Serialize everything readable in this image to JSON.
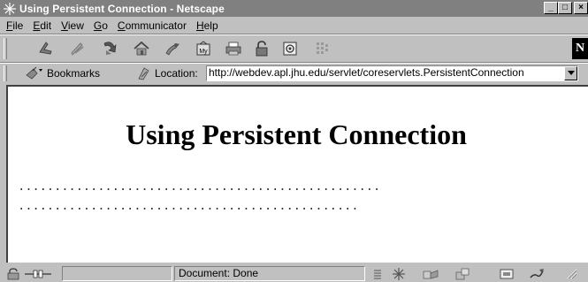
{
  "window": {
    "title": "Using Persistent Connection - Netscape",
    "buttons": {
      "minimize": "_",
      "maximize": "□",
      "close": "×"
    }
  },
  "menubar": {
    "items": [
      {
        "accel": "F",
        "rest": "ile"
      },
      {
        "accel": "E",
        "rest": "dit"
      },
      {
        "accel": "V",
        "rest": "iew"
      },
      {
        "accel": "G",
        "rest": "o"
      },
      {
        "accel": "C",
        "rest": "ommunicator"
      },
      {
        "accel": "H",
        "rest": "elp"
      }
    ]
  },
  "toolbar": {
    "icons": [
      "back-icon",
      "forward-icon",
      "reload-icon",
      "home-icon",
      "search-icon",
      "my-netscape-icon",
      "print-icon",
      "security-icon",
      "shop-icon",
      "stop-icon"
    ],
    "mynetscape_text": "My",
    "logo_text": "N"
  },
  "location": {
    "bookmarks_label": "Bookmarks",
    "location_label": "Location:",
    "url": "http://webdev.apl.jhu.edu/servlet/coreservlets.PersistentConnection"
  },
  "page": {
    "heading": "Using Persistent Connection",
    "dots_line_1": "..................................................",
    "dots_line_2": "..............................................."
  },
  "status": {
    "text": "Document: Done"
  },
  "colors": {
    "chrome": "#c0c0c0",
    "titlebar": "#808080",
    "content_bg": "#ffffff"
  }
}
